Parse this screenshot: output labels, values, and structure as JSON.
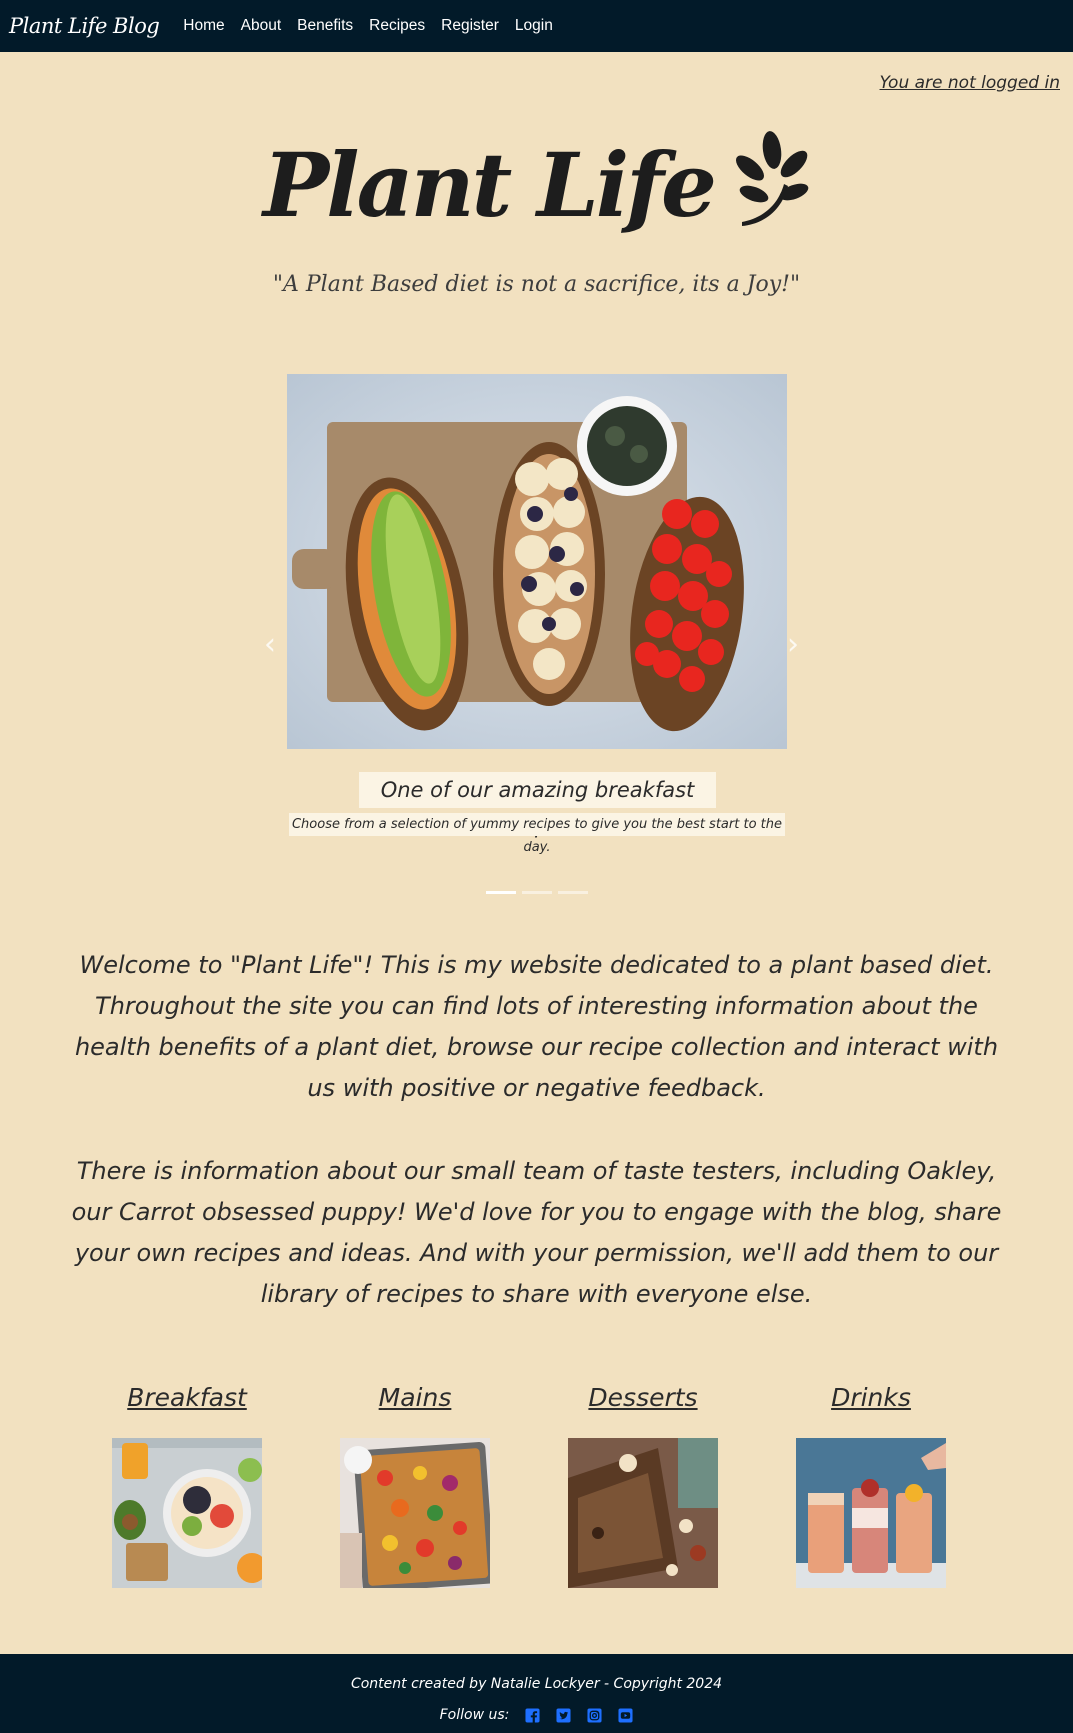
{
  "navbar": {
    "brand": "Plant Life Blog",
    "links": [
      "Home",
      "About",
      "Benefits",
      "Recipes",
      "Register",
      "Login"
    ]
  },
  "auth": {
    "status": "You are not logged in"
  },
  "hero": {
    "title": "Plant Life",
    "tagline": "\"A Plant Based diet is not a sacrifice, its a Joy!\""
  },
  "carousel": {
    "caption_title": "One of our amazing breakfast recipes.",
    "caption_text": "Choose from a selection of yummy recipes to give you the best start to the day.",
    "slide_count": 3,
    "active_index": 0
  },
  "intro": {
    "paragraph_1": "Welcome to \"Plant Life\"! This is my website dedicated to a plant based diet. Throughout the site you can find lots of interesting information about the health benefits of a plant diet, browse our recipe collection and interact with us with positive or negative feedback.",
    "paragraph_2": "There is information about our small team of taste testers, including Oakley, our Carrot obsessed puppy! We'd love for you to engage with the blog, share your own recipes and ideas. And with your permission, we'll add them to our library of recipes to share with everyone else."
  },
  "categories": [
    {
      "title": "Breakfast"
    },
    {
      "title": "Mains"
    },
    {
      "title": "Desserts"
    },
    {
      "title": "Drinks"
    }
  ],
  "footer": {
    "credit": "Content created by Natalie Lockyer - Copyright 2024",
    "follow_label": "Follow us:",
    "social_icons": [
      "facebook-icon",
      "twitter-icon",
      "instagram-icon",
      "youtube-icon"
    ],
    "icon_color": "#1e6fff"
  },
  "colors": {
    "navbar_bg": "#021a29",
    "page_bg": "#f2e1c0",
    "text": "#2b2b2b"
  }
}
